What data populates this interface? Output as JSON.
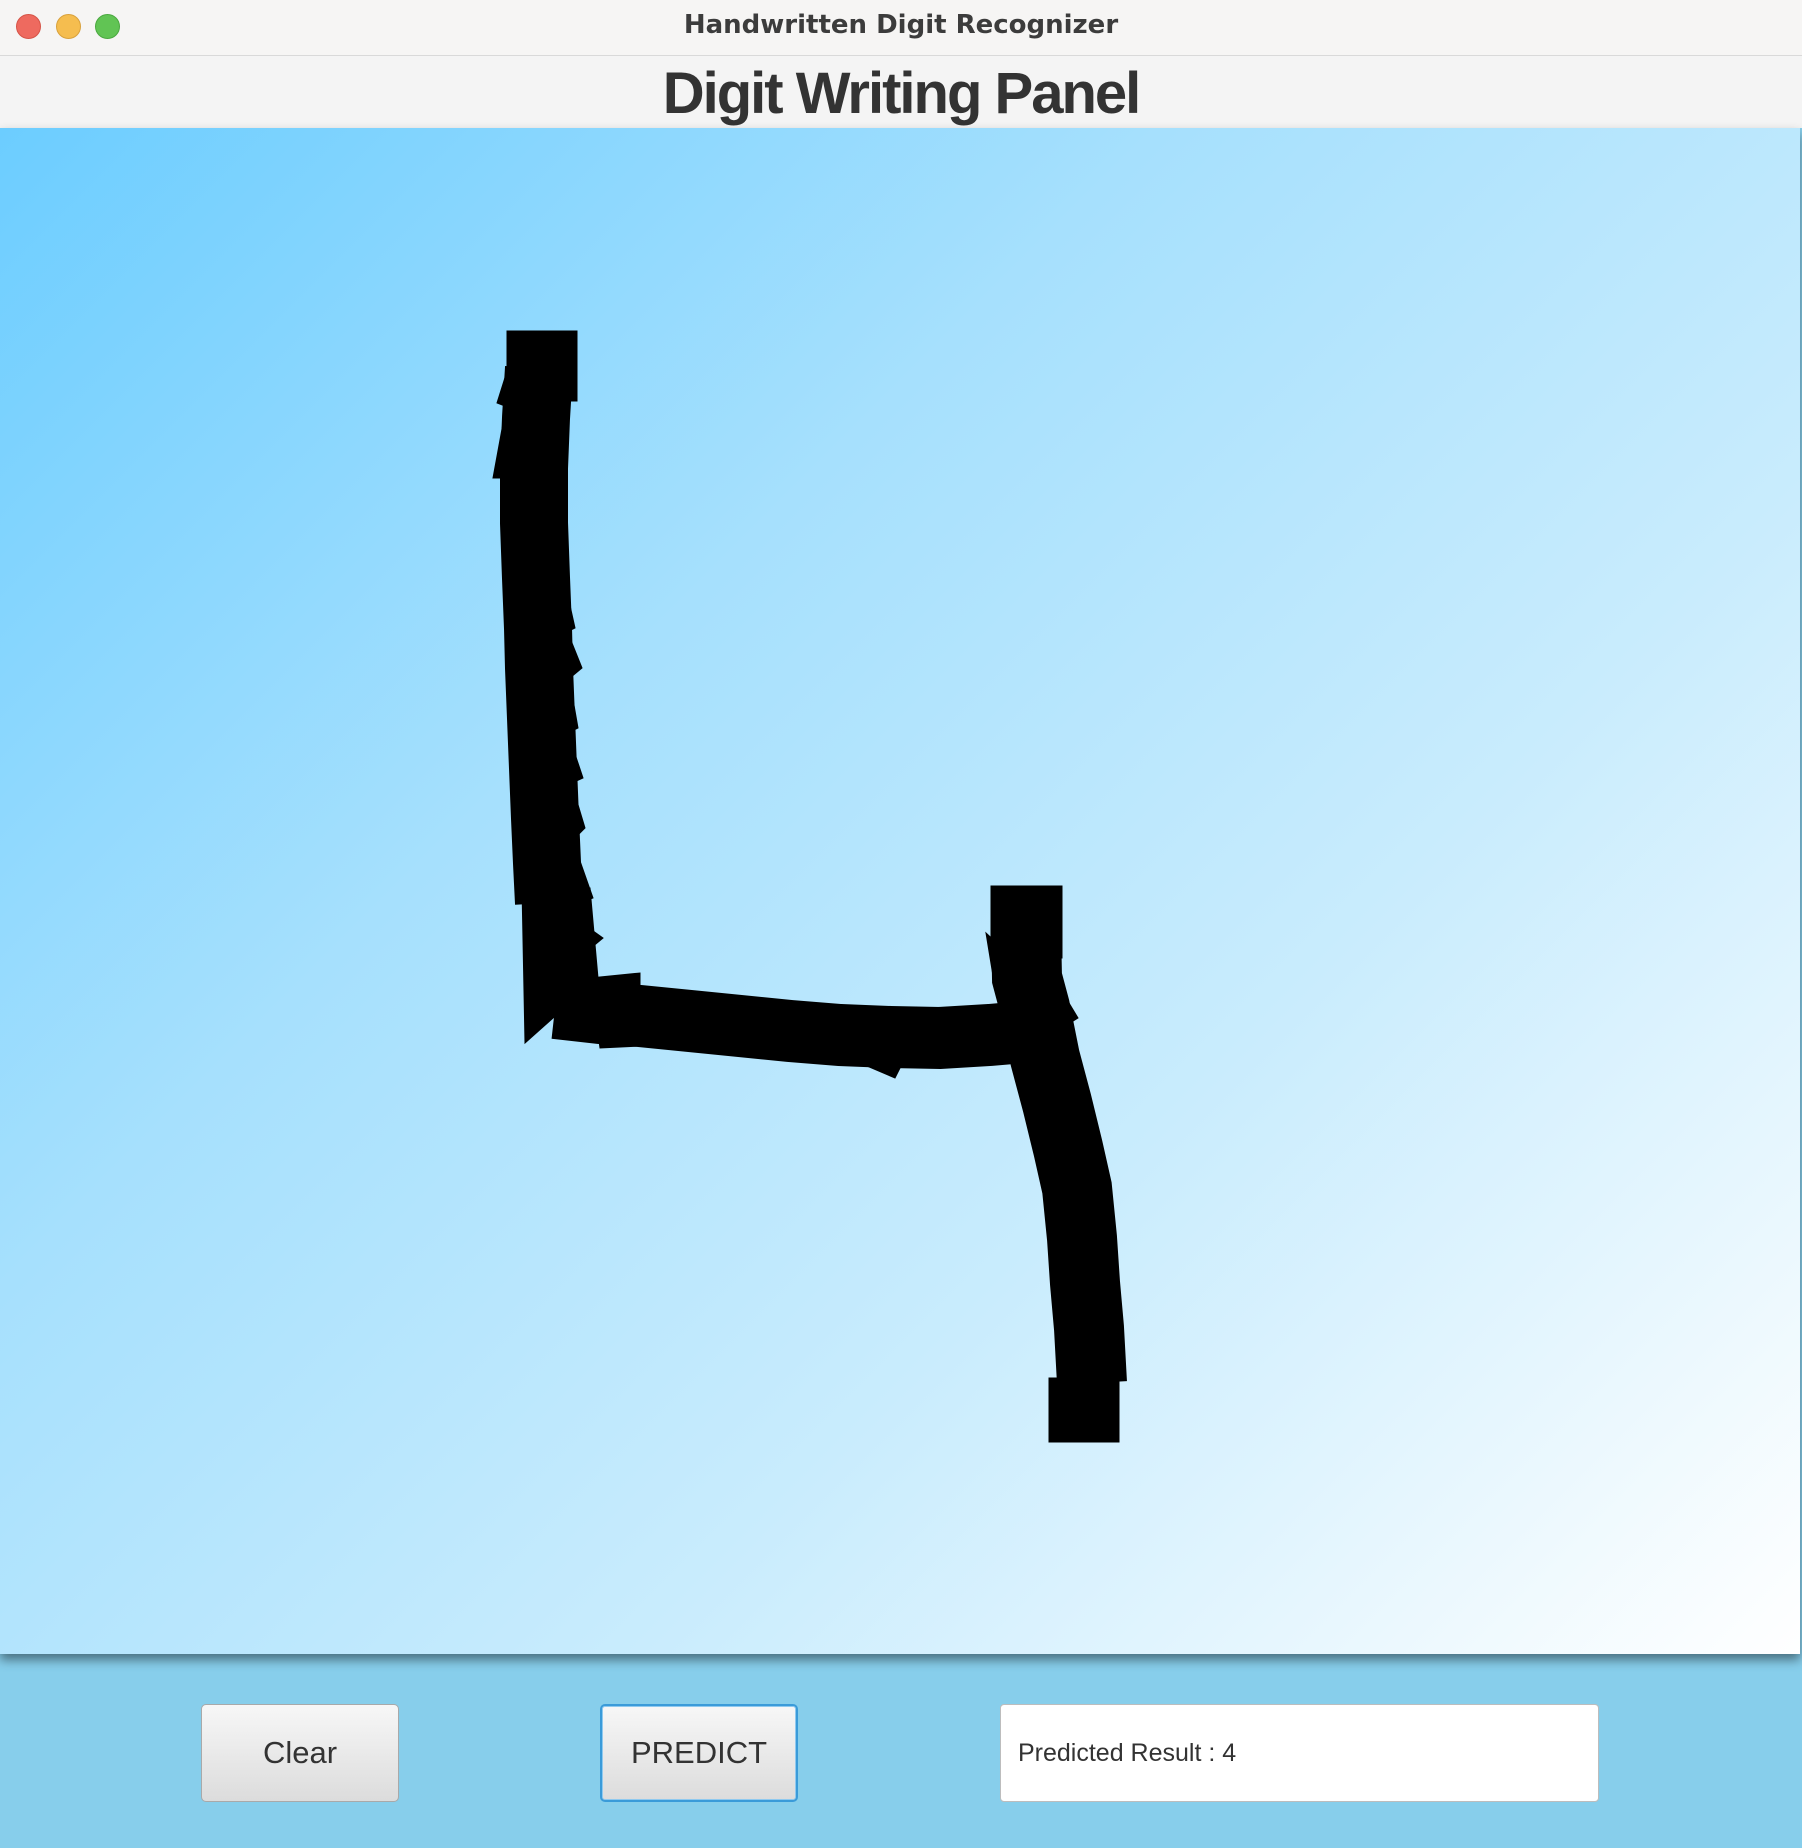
{
  "window": {
    "title": "Handwritten Digit Recognizer"
  },
  "panel": {
    "heading": "Digit Writing Panel"
  },
  "canvas": {
    "drawn_digit": "4",
    "stroke_color": "#000000",
    "background_gradient": [
      "#6ccdff",
      "#ffffff"
    ]
  },
  "controls": {
    "clear_label": "Clear",
    "predict_label": "PREDICT",
    "result_text": "Predicted Result : 4"
  },
  "colors": {
    "bottom_bar": "#87ceeb",
    "focus_border": "#3a9bd9"
  }
}
